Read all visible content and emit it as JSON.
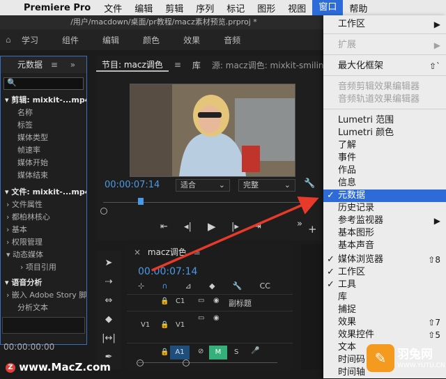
{
  "menubar": {
    "app": "Premiere Pro",
    "items": [
      "文件",
      "编辑",
      "剪辑",
      "序列",
      "标记",
      "图形",
      "视图",
      "窗口",
      "帮助"
    ],
    "active_index": 7
  },
  "titlebar": {
    "path": "/用户/macdown/桌面/pr教程/macz素材预览.prproj *"
  },
  "workspaces": [
    "学习",
    "组件",
    "编辑",
    "颜色",
    "效果",
    "音频"
  ],
  "metadata_panel": {
    "tab": "元数据",
    "search_icon": "🔍",
    "clip_section": "剪辑: mixkit-...mp4",
    "clip_fields": [
      "名称",
      "标签",
      "媒体类型",
      "帧速率",
      "媒体开始",
      "媒体结束"
    ],
    "file_section": "文件: mixkit-...mp4",
    "file_fields": [
      "文件属性",
      "都柏林核心",
      "基本",
      "权限管理",
      "动态媒体"
    ],
    "project_ref": "项目引用",
    "speech_section": "语音分析",
    "speech_fields": [
      "嵌入 Adobe Story 脚",
      "分析文本"
    ],
    "timecode": "00:00:00:00"
  },
  "program_monitor": {
    "tab": "节目: macz调色",
    "lib_tab": "库",
    "source_tab": "源: macz调色: mixkit-smilin",
    "timecode": "00:00:07:14",
    "fit": "适合",
    "quality": "完整"
  },
  "timeline": {
    "tab": "macz调色",
    "timecode": "00:00:07:14",
    "tracks": {
      "c1": "C1",
      "caption": "副标题",
      "v1": "V1",
      "a1": "A1",
      "m": "M",
      "s": "S"
    }
  },
  "window_menu": {
    "items": [
      {
        "label": "工作区",
        "shortcut": "▶",
        "disabled": false,
        "checked": false
      },
      {
        "label": "扩展",
        "shortcut": "▶",
        "disabled": true,
        "checked": false
      },
      {
        "label": "最大化框架",
        "shortcut": "⇧`",
        "disabled": false,
        "checked": false
      },
      {
        "label": "音频剪辑效果编辑器",
        "shortcut": "",
        "disabled": true,
        "checked": false
      },
      {
        "label": "音频轨道效果编辑器",
        "shortcut": "",
        "disabled": true,
        "checked": false
      },
      {
        "label": "Lumetri 范围",
        "shortcut": "",
        "disabled": false,
        "checked": false
      },
      {
        "label": "Lumetri 颜色",
        "shortcut": "",
        "disabled": false,
        "checked": false
      },
      {
        "label": "了解",
        "shortcut": "",
        "disabled": false,
        "checked": false
      },
      {
        "label": "事件",
        "shortcut": "",
        "disabled": false,
        "checked": false
      },
      {
        "label": "作品",
        "shortcut": "",
        "disabled": false,
        "checked": false
      },
      {
        "label": "信息",
        "shortcut": "",
        "disabled": false,
        "checked": false
      },
      {
        "label": "元数据",
        "shortcut": "",
        "disabled": false,
        "checked": true,
        "selected": true
      },
      {
        "label": "历史记录",
        "shortcut": "",
        "disabled": false,
        "checked": false
      },
      {
        "label": "参考监视器",
        "shortcut": "▶",
        "disabled": false,
        "checked": false
      },
      {
        "label": "基本图形",
        "shortcut": "",
        "disabled": false,
        "checked": false
      },
      {
        "label": "基本声音",
        "shortcut": "",
        "disabled": false,
        "checked": false
      },
      {
        "label": "媒体浏览器",
        "shortcut": "⇧8",
        "disabled": false,
        "checked": true
      },
      {
        "label": "工作区",
        "shortcut": "",
        "disabled": false,
        "checked": true
      },
      {
        "label": "工具",
        "shortcut": "",
        "disabled": false,
        "checked": true
      },
      {
        "label": "库",
        "shortcut": "",
        "disabled": false,
        "checked": false
      },
      {
        "label": "捕捉",
        "shortcut": "",
        "disabled": false,
        "checked": false
      },
      {
        "label": "效果",
        "shortcut": "⇧7",
        "disabled": false,
        "checked": false
      },
      {
        "label": "效果控件",
        "shortcut": "⇧5",
        "disabled": false,
        "checked": false
      },
      {
        "label": "文本",
        "shortcut": "",
        "disabled": false,
        "checked": false
      },
      {
        "label": "时间码",
        "shortcut": "",
        "disabled": false,
        "checked": false
      },
      {
        "label": "时间轴",
        "shortcut": "",
        "disabled": false,
        "checked": false
      }
    ]
  },
  "watermarks": {
    "macz": "www.MacZ.com",
    "yutu_cn": "羽兔网",
    "yutu_url": "WWW.YUTU.CN"
  },
  "colors": {
    "accent_blue": "#2d6bd8",
    "timecode_blue": "#4a9ae8",
    "arrow_red": "#e83a2a",
    "yutu_orange": "#f39a1f"
  }
}
